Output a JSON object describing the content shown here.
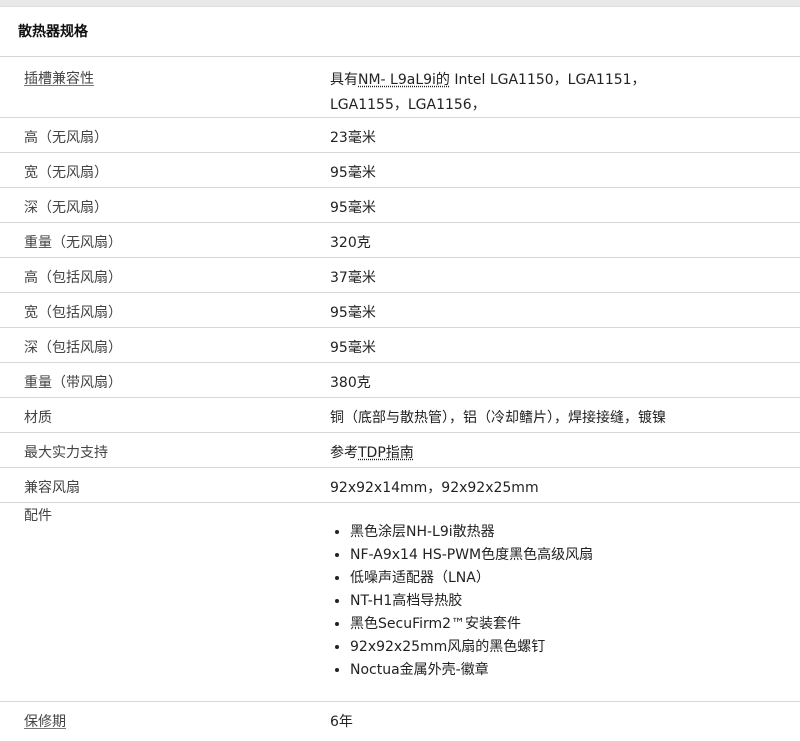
{
  "section_title": "散热器规格",
  "rows": [
    {
      "label": "插槽兼容性",
      "value_prefix": "具有",
      "value_link": "NM- L9aL9i的",
      "value_rest": " Intel LGA1150，LGA1151，",
      "value_line2": "LGA1155，LGA1156，"
    },
    {
      "label": "高（无风扇）",
      "value": "23毫米"
    },
    {
      "label": "宽（无风扇）",
      "value": "95毫米"
    },
    {
      "label": "深（无风扇）",
      "value": "95毫米"
    },
    {
      "label": "重量（无风扇）",
      "value": "320克"
    },
    {
      "label": "高（包括风扇）",
      "value": "37毫米"
    },
    {
      "label": "宽（包括风扇）",
      "value": "95毫米"
    },
    {
      "label": "深（包括风扇）",
      "value": "95毫米"
    },
    {
      "label": "重量（带风扇）",
      "value": "380克"
    },
    {
      "label": "材质",
      "value": "铜（底部与散热管），铝（冷却鳍片），焊接接缝，镀镍"
    },
    {
      "label": "最大实力支持",
      "value_prefix": "参考",
      "value_link": "TDP指南"
    },
    {
      "label": "兼容风扇",
      "value": "92x92x14mm，92x92x25mm"
    },
    {
      "label": "配件",
      "items": [
        "黑色涂层NH-L9i散热器",
        "NF-A9x14 HS-PWM色度黑色高级风扇",
        "低噪声适配器（LNA）",
        "NT-H1高档导热胶",
        "黑色SecuFirm2™安装套件",
        "92x92x25mm风扇的黑色螺钉",
        "Noctua金属外壳-徽章"
      ]
    },
    {
      "label": "保修期",
      "value": "6年"
    }
  ]
}
